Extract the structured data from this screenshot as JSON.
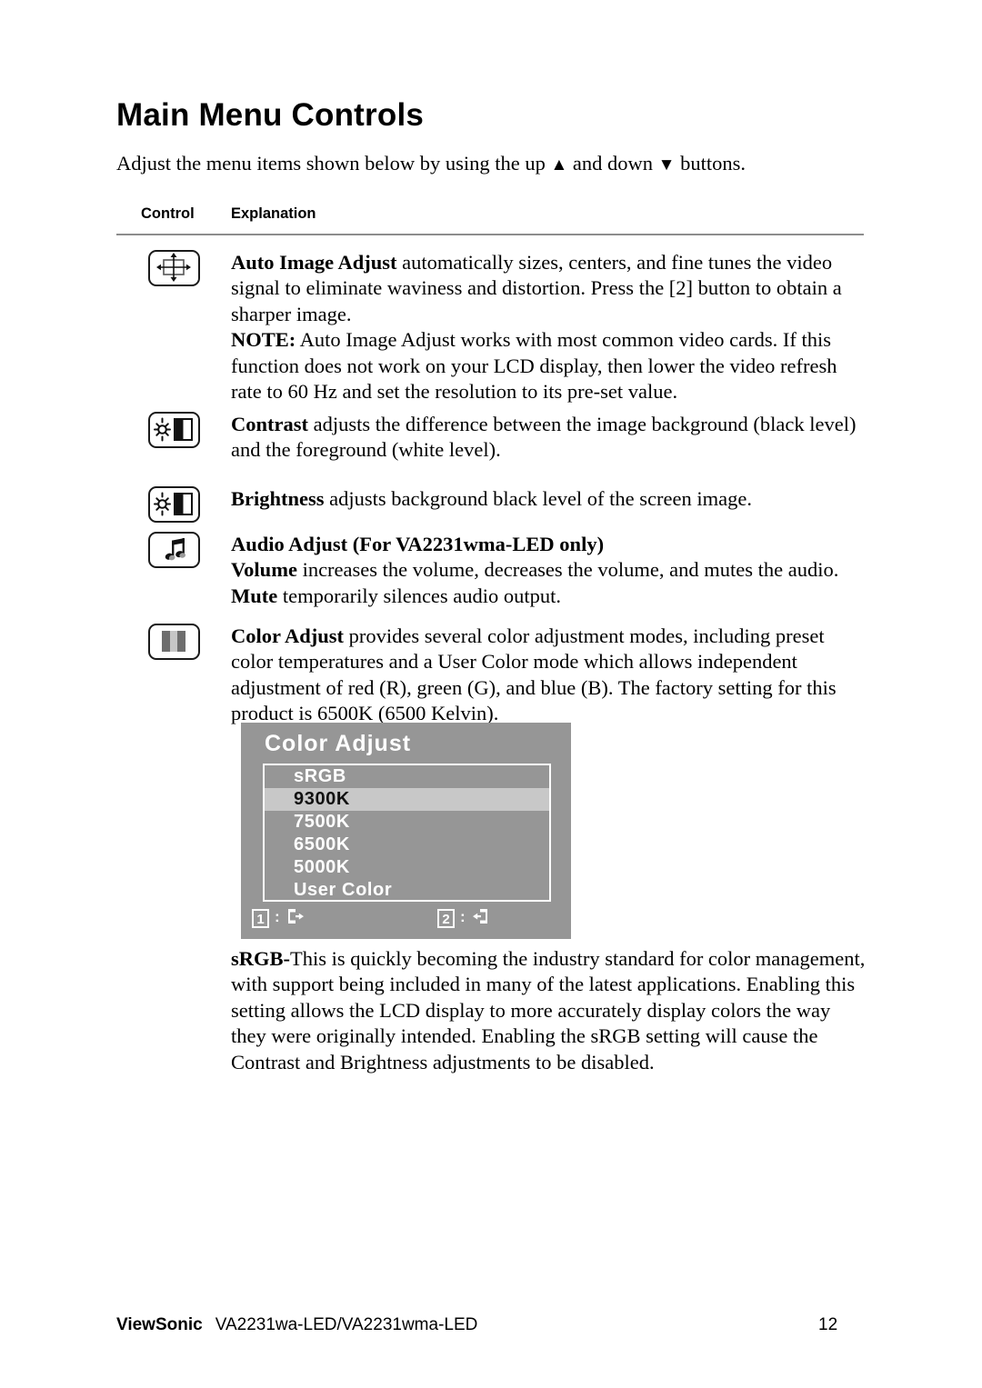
{
  "document": {
    "title": "Main Menu Controls",
    "intro_before": "Adjust the menu items shown below by using the up",
    "intro_up_glyph": "▲",
    "intro_middle": "and down",
    "intro_down_glyph": "▼",
    "intro_after": "buttons."
  },
  "table": {
    "header_control": "Control",
    "header_explanation": "Explanation"
  },
  "rows": [
    {
      "icon_name": "auto-image-adjust-icon",
      "paragraphs": [
        {
          "bold": "Auto Image Adjust",
          "text": " automatically sizes, centers, and fine tunes the video signal to eliminate waviness and distortion. Press the [2] button to obtain a sharper image."
        },
        {
          "bold": "NOTE:",
          "text": " Auto Image Adjust works with most common video cards. If this function does not work on your LCD display, then lower the video refresh rate to 60 Hz and set the resolution to its pre-set value."
        }
      ]
    },
    {
      "icon_name": "contrast-icon",
      "paragraphs": [
        {
          "bold": "Contrast",
          "text": " adjusts the difference between the image background  (black level) and the foreground (white level)."
        }
      ]
    },
    {
      "icon_name": "brightness-icon",
      "paragraphs": [
        {
          "bold": "Brightness",
          "text": " adjusts background black level of the screen image."
        }
      ]
    },
    {
      "icon_name": "audio-adjust-icon",
      "paragraphs": [
        {
          "bold": "Audio Adjust (For VA2231wma-LED only)",
          "text": ""
        },
        {
          "bold": "Volume",
          "text": " increases the volume, decreases the volume, and mutes the audio."
        },
        {
          "bold": "Mute",
          "text": " temporarily silences audio output."
        }
      ]
    },
    {
      "icon_name": "color-adjust-icon",
      "paragraphs": [
        {
          "bold": "Color Adjust",
          "text": " provides several color adjustment modes, including preset color temperatures and a User Color mode which allows independent adjustment of red (R), green (G), and blue (B). The factory setting for this product is 6500K (6500 Kelvin)."
        }
      ]
    }
  ],
  "osd": {
    "title": "Color Adjust",
    "items": [
      {
        "label": "sRGB",
        "selected": false
      },
      {
        "label": "9300K",
        "selected": true
      },
      {
        "label": "7500K",
        "selected": false
      },
      {
        "label": "6500K",
        "selected": false
      },
      {
        "label": "5000K",
        "selected": false
      },
      {
        "label": "User Color",
        "selected": false
      }
    ],
    "key1_label": "1",
    "key1_separator": ":",
    "key1_action": "exit-right-icon",
    "key2_label": "2",
    "key2_separator": ":",
    "key2_action": "exit-left-icon",
    "background_color": "#969696",
    "highlight_color": "#c8c8c8",
    "text_color": "#ffffff"
  },
  "srgb_note": {
    "bold": "sRGB-",
    "text": "This is quickly becoming the industry standard for color management, with support being included in many of the latest applications. Enabling this setting allows the LCD display to more accurately display colors the way they were originally intended. Enabling the sRGB setting will cause the Contrast and Brightness adjustments to be disabled."
  },
  "footer": {
    "brand": "ViewSonic",
    "model": "VA2231wa-LED/VA2231wma-LED",
    "page_number": "12"
  }
}
